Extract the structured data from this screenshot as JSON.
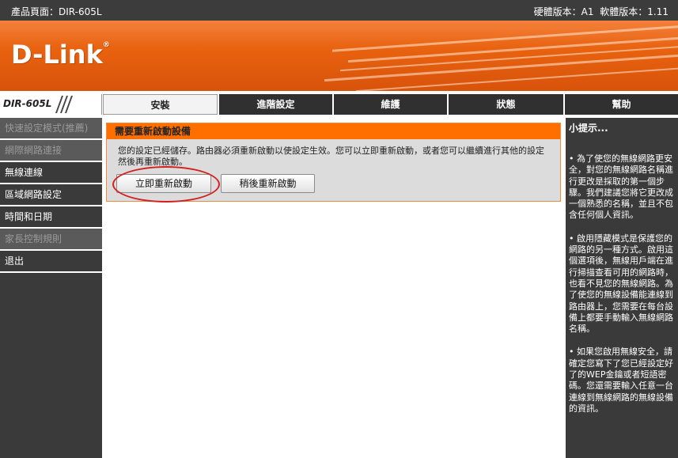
{
  "topbar": {
    "product": "產品頁面：DIR-605L",
    "versions": "硬體版本：A1   軟體版本：1.11"
  },
  "brand": {
    "logo": "D-Link",
    "model": "DIR-605L"
  },
  "tabs": [
    {
      "label": "安裝"
    },
    {
      "label": "進階設定"
    },
    {
      "label": "維護"
    },
    {
      "label": "狀態"
    },
    {
      "label": "幫助"
    }
  ],
  "sidebar": {
    "items": [
      {
        "label": "快速設定模式(推薦)"
      },
      {
        "label": "網際網路連接"
      },
      {
        "label": "無線連線"
      },
      {
        "label": "區域網路設定"
      },
      {
        "label": "時間和日期"
      },
      {
        "label": "家長控制規則"
      },
      {
        "label": "退出"
      }
    ]
  },
  "panel": {
    "title": "需要重新啟動設備",
    "message": "您的設定已經儲存。路由器必須重新啟動以使設定生效。您可以立即重新啟動，或者您可以繼續進行其他的設定然後再重新啟動。",
    "reboot_now": "立即重新啟動",
    "reboot_later": "稍後重新啟動"
  },
  "hints": {
    "title": "小提示...",
    "items": [
      "• 為了使您的無線網路更安全，對您的無線網路名稱進行更改是採取的第一個步驟。我們建議您將它更改成一個熟悉的名稱，並且不包含任何個人資訊。",
      "• 啟用隱藏模式是保護您的網路的另一種方式。啟用這個選項後，無線用戶端在進行掃描查看可用的網路時，也看不見您的無線網路。為了使您的無線設備能連線到路由器上，您需要在每台設備上都要手動輸入無線網路名稱。",
      "• 如果您啟用無線安全，請確定您寫下了您已經設定好了的WEP金鑰或者短語密碼。您還需要輸入任意一台連線到無線網路的無線設備的資訊。"
    ]
  }
}
